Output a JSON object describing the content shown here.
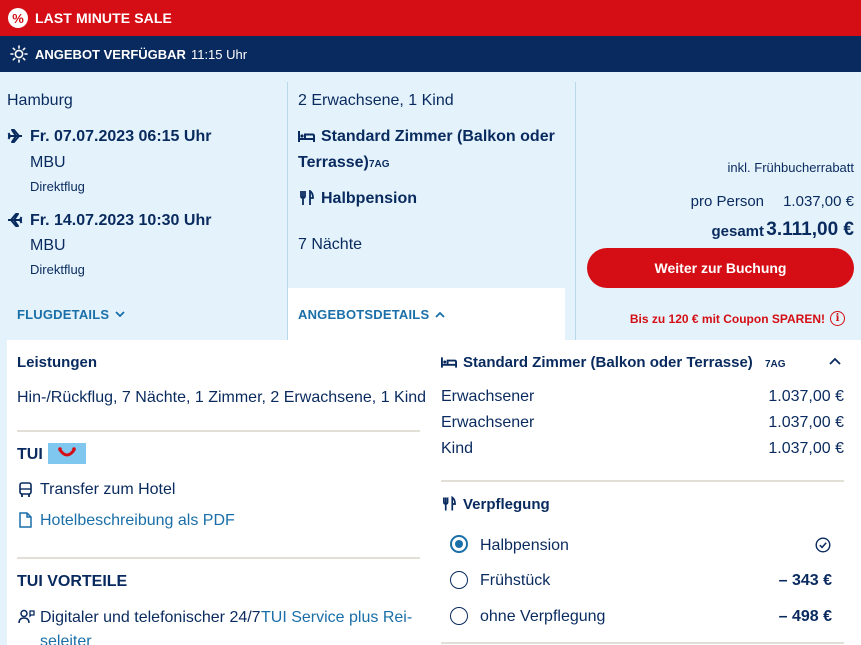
{
  "banner": {
    "sale_badge": "%",
    "sale_label": "LAST MINUTE SALE",
    "availability_label": "ANGEBOT VERFÜGBAR",
    "availability_time": "11:15 Uhr"
  },
  "flight": {
    "origin": "Hamburg",
    "outbound_date": "Fr. 07.07.2023 06:15 Uhr",
    "outbound_airport": "MBU",
    "outbound_type": "Direktflug",
    "return_date": "Fr. 14.07.2023 10:30 Uhr",
    "return_airport": "MBU",
    "return_type": "Direktflug",
    "details_link": "FLUGDETAILS"
  },
  "offer": {
    "travellers": "2 Erwachsene, 1 Kind",
    "room_line1": "Standard Zimmer (Balkon oder",
    "room_line2": "Terrasse)",
    "room_code": "7AG",
    "board": "Halbpension",
    "nights": "7 Nächte",
    "details_link": "ANGEBOTSDETAILS"
  },
  "price": {
    "discount_note": "inkl. Frühbucherrabatt",
    "per_person_label": "pro Person",
    "per_person_value": "1.037,00 €",
    "total_label": "gesamt",
    "total_value": "3.111,00 €",
    "cta": "Weiter zur Buchung",
    "coupon": "Bis zu 120 € mit Coupon SPAREN!",
    "info_icon": "i"
  },
  "details": {
    "services_title": "Leistungen",
    "services_text": "Hin-/Rückflug, 7 Nächte, 1 Zimmer, 2 Erwachsene, 1 Kind",
    "brand": "TUI",
    "transfer": "Transfer zum Hotel",
    "hotel_pdf": "Hotelbeschreibung als PDF",
    "advantages_title": "TUI VORTEILE",
    "advantage_text": "Digitaler und telefonischer 24/7",
    "advantage_link_1": "TUI Service plus Rei-",
    "advantage_link_2": "seleiter"
  },
  "room_breakdown": {
    "title": "Standard Zimmer (Balkon oder Terrasse)",
    "code": "7AG",
    "rows": [
      {
        "label": "Erwachsener",
        "value": "1.037,00 €"
      },
      {
        "label": "Erwachsener",
        "value": "1.037,00 €"
      },
      {
        "label": "Kind",
        "value": "1.037,00 €"
      }
    ]
  },
  "board_options": {
    "title": "Verpflegung",
    "options": [
      {
        "label": "Halbpension",
        "value": "",
        "selected": true
      },
      {
        "label": "Frühstück",
        "value": "– 343 €",
        "selected": false
      },
      {
        "label": "ohne Verpflegung",
        "value": "– 498 €",
        "selected": false
      }
    ]
  },
  "colors": {
    "brand_red": "#d40e14",
    "navy": "#092a5e",
    "link_blue": "#1a6fa9",
    "light_blue_bg": "#e4f3fb"
  }
}
